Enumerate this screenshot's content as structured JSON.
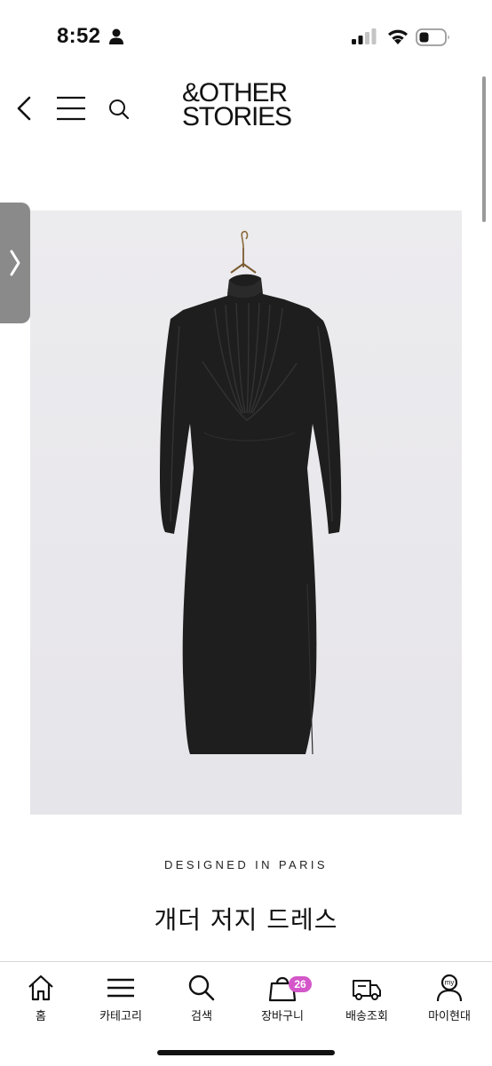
{
  "status_bar": {
    "time": "8:52",
    "icons": [
      "person-icon",
      "signal-icon",
      "wifi-icon",
      "battery-icon"
    ]
  },
  "header": {
    "icons": [
      "back-chevron-icon",
      "hamburger-menu-icon",
      "search-icon"
    ],
    "brand_line1": "&OTHER",
    "brand_line2": "STORIES"
  },
  "side_tab": {
    "icon": "chevron-right-icon"
  },
  "product": {
    "image_subject": "black-dress-on-hanger",
    "tagline": "DESIGNED IN PARIS",
    "title": "개더 저지 드레스"
  },
  "bottom_nav": {
    "items": [
      {
        "icon": "home-icon",
        "label": "홈"
      },
      {
        "icon": "category-menu-icon",
        "label": "카테고리"
      },
      {
        "icon": "search-icon",
        "label": "검색"
      },
      {
        "icon": "shopping-bag-icon",
        "label": "장바구니",
        "badge": "26"
      },
      {
        "icon": "delivery-truck-icon",
        "label": "배송조회"
      },
      {
        "icon": "my-page-person-icon",
        "label": "마이현대"
      }
    ]
  },
  "colors": {
    "badge": "#d457c9",
    "side_tab": "#8a8a8a",
    "image_background": "#e9e8ec",
    "dress": "#1e1e1e"
  }
}
